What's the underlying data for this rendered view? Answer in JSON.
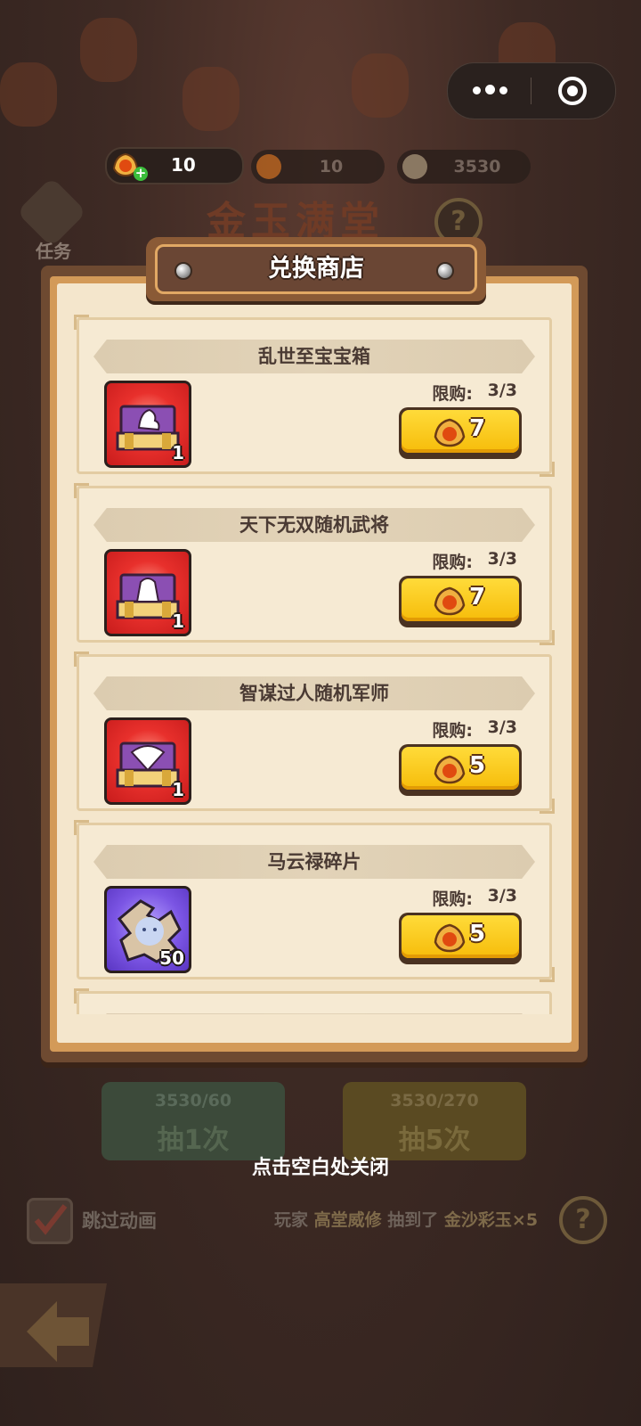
{
  "hud": {
    "orange_gem": "10",
    "red_gem": "10",
    "ingot": "3530"
  },
  "background": {
    "title": "金玉满堂",
    "task_label": "任务",
    "draw_once": {
      "cost": "3530/60",
      "label": "抽1次"
    },
    "draw_five": {
      "cost": "3530/270",
      "label": "抽5次"
    },
    "skip_animation": "跳过动画",
    "feed": {
      "prefix": "玩家",
      "player": "高堂威修",
      "verb": "抽到了",
      "prize": "金沙彩玉×5"
    }
  },
  "shop": {
    "title": "兑换商店",
    "limit_label": "限购:",
    "items": [
      {
        "name": "乱世至宝宝箱",
        "qty": "1",
        "limit": "3/3",
        "price": "7",
        "icon": "treasure-chest-icon",
        "color": "#e8302c"
      },
      {
        "name": "天下无双随机武将",
        "qty": "1",
        "limit": "3/3",
        "price": "7",
        "icon": "general-chest-icon",
        "color": "#e8302c"
      },
      {
        "name": "智谋过人随机军师",
        "qty": "1",
        "limit": "3/3",
        "price": "5",
        "icon": "strategist-chest-icon",
        "color": "#e8302c"
      },
      {
        "name": "马云禄碎片",
        "qty": "50",
        "limit": "3/3",
        "price": "5",
        "icon": "hero-fragment-icon",
        "color": "#7b55e4"
      }
    ]
  },
  "close_hint": "点击空白处关闭"
}
